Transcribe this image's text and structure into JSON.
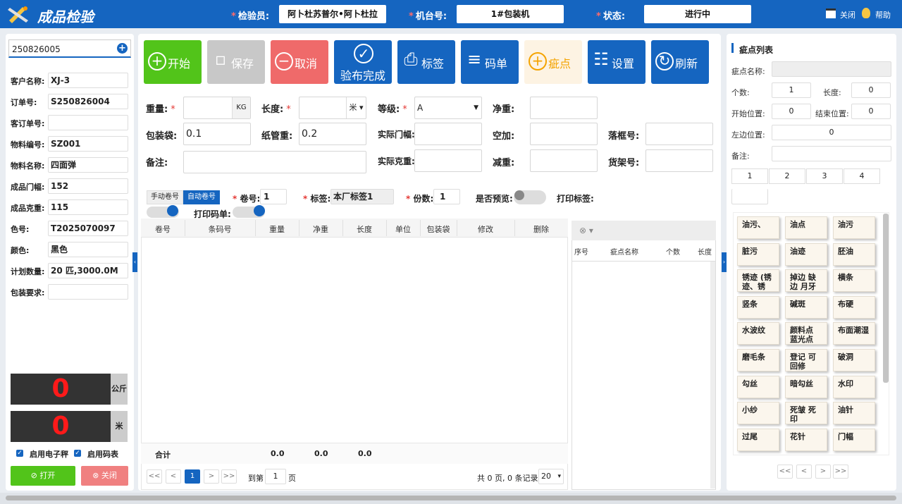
{
  "header": {
    "title": "成品检验",
    "inspector_label": "检验员:",
    "inspector_value": "阿卜杜苏普尔•阿卜杜拉",
    "machine_label": "机台号:",
    "machine_value": "1#包装机",
    "status_label": "状态:",
    "status_value": "进行中",
    "close_label": "关闭",
    "help_label": "帮助",
    "accent": "#1565c0"
  },
  "left": {
    "search_value": "250826005",
    "fields": [
      {
        "label": "客户名称:",
        "value": "XJ-3"
      },
      {
        "label": "订单号:",
        "value": "S250826004"
      },
      {
        "label": "客订单号:",
        "value": ""
      },
      {
        "label": "物料编号:",
        "value": "SZ001"
      },
      {
        "label": "物料名称:",
        "value": "四面弹"
      },
      {
        "label": "成品门幅:",
        "value": "152"
      },
      {
        "label": "成品克重:",
        "value": "115"
      },
      {
        "label": "色号:",
        "value": "T2025070097"
      },
      {
        "label": "颜色:",
        "value": "黑色"
      },
      {
        "label": "计划数量:",
        "value": "20 匹,3000.0M"
      },
      {
        "label": "包装要求:",
        "value": ""
      }
    ],
    "weight_value": "0",
    "weight_unit": "公斤",
    "length_value": "0",
    "length_unit": "米",
    "scale_label": "启用电子秤",
    "meter_label": "启用码表",
    "open_label": "打开",
    "close_label": "关闭"
  },
  "toolbar": [
    {
      "label": "开始",
      "icon": "plus-circle-icon",
      "color": "#52c41a"
    },
    {
      "label": "保存",
      "icon": "save-icon",
      "color": "#c8c8c8"
    },
    {
      "label": "取消",
      "icon": "minus-circle-icon",
      "color": "#ef6a6a"
    },
    {
      "label": "验布完成",
      "icon": "check-circle-icon",
      "color": "#1565c0"
    },
    {
      "label": "标签",
      "icon": "printer-icon",
      "color": "#1565c0"
    },
    {
      "label": "码单",
      "icon": "list-icon",
      "color": "#1565c0"
    },
    {
      "label": "疵点",
      "icon": "plus-circle-icon",
      "color": "#fdf3e3"
    },
    {
      "label": "设置",
      "icon": "settings-list-icon",
      "color": "#1565c0"
    },
    {
      "label": "刷新",
      "icon": "refresh-icon",
      "color": "#1565c0"
    }
  ],
  "form": {
    "weight_label": "重量:",
    "weight_unit": "KG",
    "length_label": "长度:",
    "length_unit": "米",
    "grade_label": "等级:",
    "grade_value": "A",
    "net_label": "净重:",
    "bag_label": "包装袋:",
    "bag_value": "0.1",
    "tube_label": "纸管重:",
    "tube_value": "0.2",
    "actual_width_label": "实际门幅:",
    "empty_add_label": "空加:",
    "frame_label": "落框号:",
    "remark_label": "备注:",
    "actual_gsm_label": "实际克重:",
    "deduct_label": "减重:",
    "shelf_label": "货架号:"
  },
  "roll": {
    "manual_label": "手动卷号",
    "auto_label": "自动卷号",
    "roll_no_label": "卷号:",
    "roll_no_value": "1",
    "tag_label": "标签:",
    "tag_value": "本厂标签1",
    "copies_label": "份数:",
    "copies_value": "1",
    "preview_label": "是否预览:",
    "print_tag_label": "打印标签:",
    "print_code_label": "打印码单:"
  },
  "table": {
    "columns": [
      "卷号",
      "条码号",
      "重量",
      "净重",
      "长度",
      "单位",
      "包装袋",
      "修改",
      "删除"
    ],
    "total_label": "合计",
    "totals": [
      "0.0",
      "0.0",
      "0.0"
    ],
    "page_to_label": "到第",
    "page_value": "1",
    "page_unit": "页",
    "summary": "共 0 页, 0 条记录",
    "page_size": "20",
    "current_page": "1"
  },
  "defect_table": {
    "columns": [
      "序号",
      "疵点名称",
      "个数",
      "长度"
    ]
  },
  "right": {
    "title": "疵点列表",
    "name_label": "疵点名称:",
    "count_label": "个数:",
    "count_value": "1",
    "length_label": "长度:",
    "length_value": "0",
    "start_label": "开始位置:",
    "start_value": "0",
    "end_label": "结束位置:",
    "end_value": "0",
    "left_label": "左边位置:",
    "left_value": "0",
    "remark_label": "备注:",
    "tabs": [
      "1",
      "2",
      "3",
      "4"
    ],
    "defects": [
      "油污、",
      "油点",
      "油污",
      "脏污",
      "油迹",
      "胚油",
      "锈迹 (锈迹、锈",
      "掉边 缺边 月牙边",
      "横条",
      "竖条",
      "碱斑",
      "布硬",
      "水波纹",
      "颜料点 蓝光点",
      "布面潮湿",
      "磨毛条",
      "登记 可回修",
      "破洞",
      "勾丝",
      "暗勾丝",
      "水印",
      "小纱",
      "死皱 死印",
      "油针",
      "过尾",
      "花针",
      "门幅"
    ]
  }
}
